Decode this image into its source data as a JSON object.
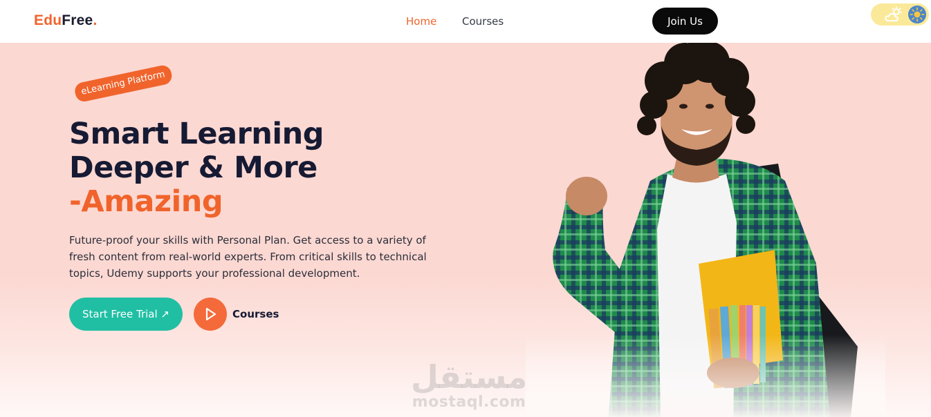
{
  "header": {
    "logo": {
      "edu": "Edu",
      "free": "Free",
      "dot": "."
    },
    "nav": [
      {
        "label": "Home",
        "active": true
      },
      {
        "label": "Courses",
        "active": false
      }
    ],
    "join_label": "Join Us",
    "theme_toggle_icons": [
      "cloud-sun-icon",
      "sun-icon"
    ]
  },
  "hero": {
    "badge": "eLearning Platform",
    "headline_line1": "Smart Learning",
    "headline_line2": "Deeper & More",
    "headline_accent": "-Amazing",
    "description": "Future-proof your skills with Personal Plan. Get access to a variety of fresh content from real-world experts. From critical skills to technical topics, Udemy supports your professional development.",
    "trial_label": "Start Free Trial ↗",
    "courses_label": "Courses"
  },
  "watermark": {
    "arabic": "مستقل",
    "latin": "mostaql.com"
  },
  "colors": {
    "brand_orange": "#f0642c",
    "teal": "#20bfa4",
    "hero_bg": "#fcd8d2",
    "dark_text": "#161a33"
  }
}
